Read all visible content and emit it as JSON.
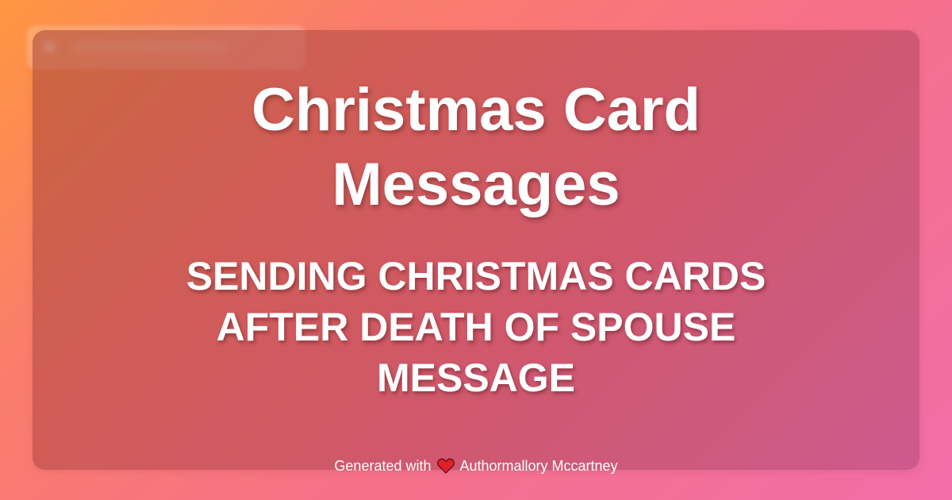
{
  "card": {
    "title_lines": [
      "Christmas Card",
      "Messages"
    ],
    "subtitle_lines": [
      "SENDING CHRISTMAS CARDS",
      "AFTER DEATH OF SPOUSE",
      "MESSAGE"
    ]
  },
  "footer": {
    "prefix": "Generated with",
    "icon": "heart-icon",
    "author": "Authormallory Mccartney"
  },
  "colors": {
    "heart": "#e0202a",
    "text": "#ffffff"
  }
}
